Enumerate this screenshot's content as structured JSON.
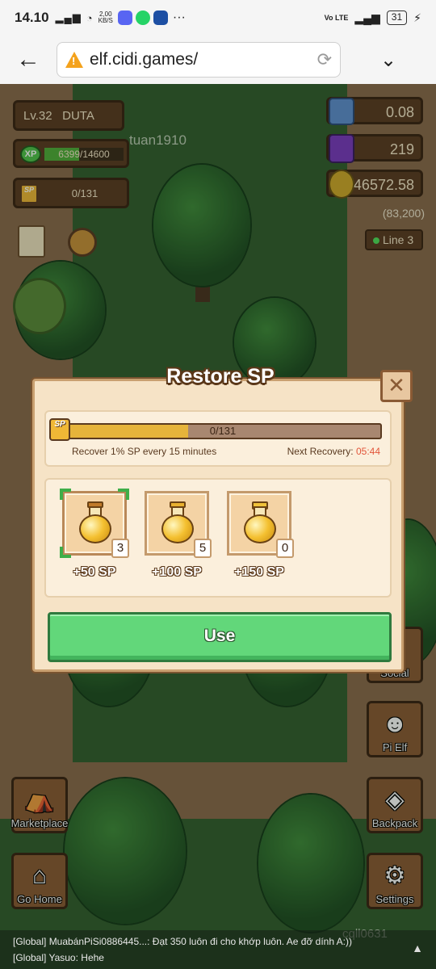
{
  "statusbar": {
    "time": "14.10",
    "net_speed_value": "2,00",
    "net_speed_unit": "KB/S",
    "battery": "31",
    "volte": "Vo LTE"
  },
  "browser": {
    "url": "elf.cidi.games/"
  },
  "hud": {
    "level": "Lv.32",
    "player_name": "DUTA",
    "xp_label": "XP",
    "xp": "6399/14600",
    "xp_fraction": 0.438,
    "sp_label": "SP",
    "sp": "0/131",
    "currency1": "0.08",
    "currency2": "219",
    "currency3": "46572.58",
    "coords": "(83,200)",
    "line": "Line 3",
    "other_player": "tuan1910",
    "other_player2": "cqll0631"
  },
  "side_buttons": {
    "marketplace": "Marketplace",
    "go_home": "Go Home",
    "social": "Social",
    "pi_elf": "Pi Elf",
    "backpack": "Backpack",
    "settings": "Settings"
  },
  "modal": {
    "title": "Restore SP",
    "close": "✕",
    "sp_icon": "SP",
    "sp_value": "0/131",
    "sp_fraction": 0.39,
    "recover_text": "Recover 1% SP every 15 minutes",
    "next_recovery_label": "Next Recovery:",
    "next_recovery_time": "05:44",
    "items": [
      {
        "label": "+50 SP",
        "count": "3"
      },
      {
        "label": "+100 SP",
        "count": "5"
      },
      {
        "label": "+150 SP",
        "count": "0"
      }
    ],
    "use_button": "Use"
  },
  "chat": {
    "line1": "[Global] MuabánPiSi0886445...: Đạt 350 luôn đi cho khớp luôn. Ae đỡ dính A:))",
    "line2": "[Global] Yasuo: Hehe"
  },
  "colors": {
    "accent_green": "#62d77a",
    "recovery_time": "#e2553a",
    "sp_fill": "#e6b43b"
  }
}
